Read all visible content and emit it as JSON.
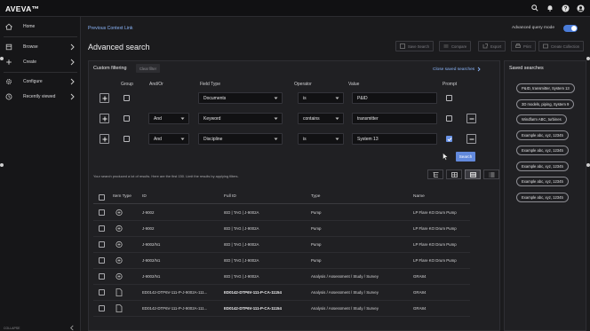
{
  "app": {
    "logo": "AVEVA™"
  },
  "topbar": {
    "icons": [
      "search-icon",
      "bell-icon",
      "help-icon",
      "user-icon"
    ]
  },
  "sidebar": {
    "items": [
      {
        "label": "Home",
        "icon": "home-icon"
      },
      {
        "label": "Browse",
        "icon": "browse-icon"
      },
      {
        "label": "Create",
        "icon": "plus-icon"
      },
      {
        "label": "Configure",
        "icon": "gear-icon"
      },
      {
        "label": "Recently viewed",
        "icon": "clock-icon"
      }
    ],
    "collapse": "COLLAPSE"
  },
  "header": {
    "context_link": "Previous Context Link",
    "title": "Advanced search",
    "advanced_query_mode": "Advanced query mode"
  },
  "toolbar": {
    "save_search": "Save Search",
    "compare": "Compare",
    "export": "Export",
    "print": "Print",
    "create_collection": "Create Collection"
  },
  "filter": {
    "title": "Custom filtering",
    "clear": "Clear filter",
    "close_saved": "Close saved searches",
    "headers": {
      "group": "Group",
      "andor": "And/Or",
      "field_type": "Field Type",
      "operator": "Operator",
      "value": "Value",
      "prompt": "Prompt"
    },
    "rows": [
      {
        "andor": "",
        "field": "Documents",
        "operator": "is",
        "value": "P&ID",
        "prompt": false
      },
      {
        "andor": "And",
        "field": "Keyword",
        "operator": "contains",
        "value": "transmitter",
        "prompt": false
      },
      {
        "andor": "And",
        "field": "Discipline",
        "operator": "is",
        "value": "System 13",
        "prompt": true
      }
    ],
    "search_button": "Search"
  },
  "results": {
    "message": "Your search produced a lot of results. Here are the first 150. Limit the results by applying filters.",
    "columns": [
      "Item Type",
      "ID",
      "Full ID",
      "Type",
      "Name"
    ],
    "rows": [
      {
        "icon": "tag-icon",
        "id": "J-9002",
        "full_id": "IED | TAG | J-9002A",
        "type": "Pump",
        "name": "LP Flare KO Drum Pump",
        "bold": false
      },
      {
        "icon": "tag-icon",
        "id": "J-9002",
        "full_id": "IED | TAG | J-9002A",
        "type": "Pump",
        "name": "LP Flare KO Drum Pump",
        "bold": false
      },
      {
        "icon": "tag-icon",
        "id": "J-9002/N1",
        "full_id": "IED | TAG | J-9002A",
        "type": "Pump",
        "name": "LP Flare KO Drum Pump",
        "bold": false
      },
      {
        "icon": "tag-icon",
        "id": "J-9002/N1",
        "full_id": "IED | TAG | J-9002A",
        "type": "Pump",
        "name": "LP Flare KO Drum Pump",
        "bold": false
      },
      {
        "icon": "tag-icon",
        "id": "J-9002/N1",
        "full_id": "IED | TAG | J-9002A",
        "type": "Analysis / Assessment / Study / Survey",
        "name": "GRA84",
        "bold": false
      },
      {
        "icon": "document-icon",
        "id": "ED0142-DTP6V-111-P-J-9002A-111...",
        "full_id": "ED0142-DTP6V-111-P-CA-11154",
        "type": "Analysis / Assessment / Study / Survey",
        "name": "GRA84",
        "bold": true
      },
      {
        "icon": "document-icon",
        "id": "ED0142-DTP6V-111-P-J-9002A-111...",
        "full_id": "ED0142-DTP6V-111-P-CA-11154",
        "type": "Analysis / Assessment / Study / Survey",
        "name": "GRA84",
        "bold": true
      }
    ]
  },
  "saved_searches": {
    "title": "Saved searches",
    "items": [
      "P&ID, transmitter, System 13",
      "3D models, piping, System 9",
      "Windfarm ABC, turbines",
      "Example abc, xyz, 12345",
      "Example abc, xyz, 12345",
      "Example abc, xyz, 12345",
      "Example abc, xyz, 12345",
      "Example abc, xyz, 12345"
    ]
  }
}
